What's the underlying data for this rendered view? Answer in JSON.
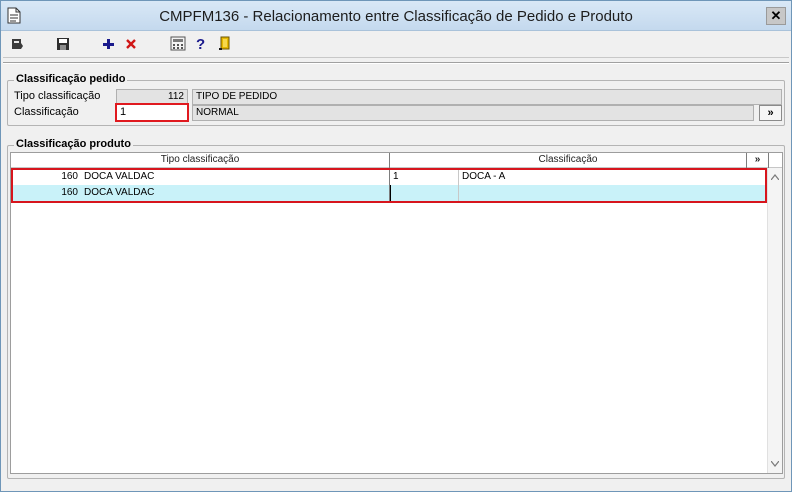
{
  "window": {
    "title": "CMPFM136 - Relacionamento entre Classificação de Pedido e Produto",
    "close_glyph": "✕"
  },
  "toolbar": {
    "icons": [
      "pin-icon",
      "save-icon",
      "add-icon",
      "delete-icon",
      "calculator-icon",
      "help-icon",
      "exit-icon"
    ]
  },
  "pedido": {
    "legend": "Classificação pedido",
    "tipo_label": "Tipo classificação",
    "tipo_code": "112",
    "tipo_desc": "TIPO DE PEDIDO",
    "class_label": "Classificação",
    "class_value": "1",
    "class_desc": "NORMAL",
    "lookup_label": "»"
  },
  "produto": {
    "legend": "Classificação produto",
    "columns": [
      "Tipo classificação",
      "Classificação"
    ],
    "more_label": "»",
    "rows": [
      {
        "tipo_code": "160",
        "tipo_desc": "DOCA VALDAC",
        "class_code": "1",
        "class_desc": "DOCA - A"
      },
      {
        "tipo_code": "160",
        "tipo_desc": "DOCA VALDAC",
        "class_code": "",
        "class_desc": ""
      }
    ]
  },
  "colors": {
    "highlight": "#d7151d",
    "selected_row": "#c9f2f9"
  }
}
